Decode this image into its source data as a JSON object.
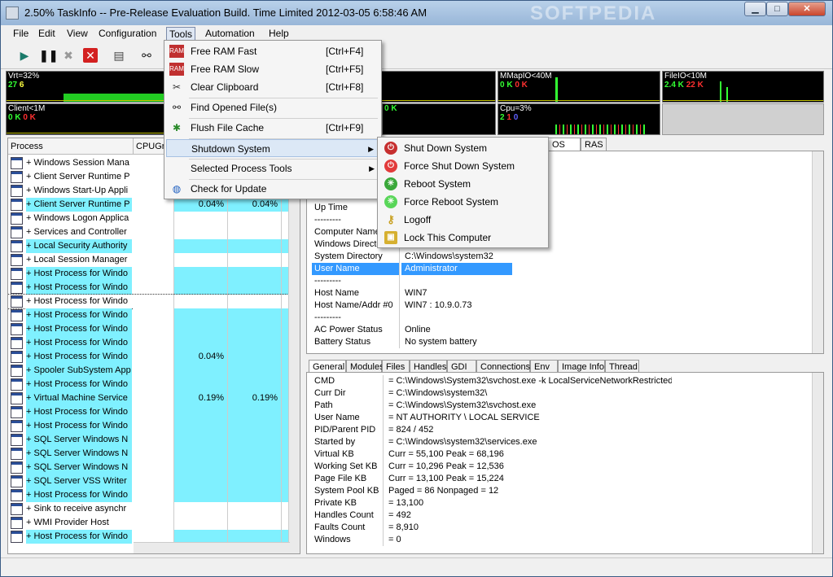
{
  "window": {
    "title": "2.50% TaskInfo -- Pre-Release Evaluation Build. Time Limited   2012-03-05 6:58:46 AM"
  },
  "watermark": "SOFTPEDIA",
  "menubar": {
    "items": [
      "File",
      "Edit",
      "View",
      "Configuration",
      "Tools",
      "Automation",
      "Help"
    ],
    "active": "Tools"
  },
  "graphs": {
    "vrt": {
      "label": "Vrt=32%",
      "v1": "27",
      "v2": "6"
    },
    "mmapio": {
      "label": "MMapIO<40M",
      "v1": "0 K",
      "v2": "0 K"
    },
    "fileio": {
      "label": "FileIO<10M",
      "v1": "2.4 K",
      "v2": "22 K"
    },
    "client": {
      "label": "Client<1M",
      "v1": "0 K",
      "v2": "0 K"
    },
    "mid2": {
      "label": "0 K"
    },
    "cpu": {
      "label": "Cpu=3%",
      "v1": "2",
      "v2": "1",
      "v3": "0"
    }
  },
  "process_panel": {
    "headers": {
      "process": "Process",
      "cpugraph": "CPUGraph"
    },
    "rows": [
      {
        "name": "+ Windows Session Mana",
        "c1": "",
        "c2": "",
        "cyan": false
      },
      {
        "name": "+ Client Server Runtime P",
        "c1": "",
        "c2": "",
        "cyan": false
      },
      {
        "name": "+ Windows Start-Up Appli",
        "c1": "",
        "c2": "",
        "cyan": false
      },
      {
        "name": "+ Client Server Runtime P",
        "c1": "0.04%",
        "c2": "0.04%",
        "cyan": true
      },
      {
        "name": "+ Windows Logon Applica",
        "c1": "",
        "c2": "",
        "cyan": false
      },
      {
        "name": "+ Services and Controller",
        "c1": "",
        "c2": "",
        "cyan": false
      },
      {
        "name": "+ Local Security Authority",
        "c1": "",
        "c2": "",
        "cyan": true
      },
      {
        "name": "+ Local Session Manager",
        "c1": "",
        "c2": "",
        "cyan": false
      },
      {
        "name": "+ Host Process for Windo",
        "c1": "",
        "c2": "",
        "cyan": true
      },
      {
        "name": "+ Host Process for Windo",
        "c1": "",
        "c2": "",
        "cyan": true
      },
      {
        "name": "+ Host Process for Windo",
        "c1": "",
        "c2": "",
        "cyan": false,
        "sel": true
      },
      {
        "name": "+ Host Process for Windo",
        "c1": "",
        "c2": "",
        "cyan": true
      },
      {
        "name": "+ Host Process for Windo",
        "c1": "",
        "c2": "",
        "cyan": true
      },
      {
        "name": "+ Host Process for Windo",
        "c1": "",
        "c2": "",
        "cyan": true
      },
      {
        "name": "+ Host Process for Windo",
        "c1": "0.04%",
        "c2": "",
        "cyan": true
      },
      {
        "name": "+ Spooler SubSystem App",
        "c1": "",
        "c2": "",
        "cyan": true
      },
      {
        "name": "+ Host Process for Windo",
        "c1": "",
        "c2": "",
        "cyan": true
      },
      {
        "name": "+ Virtual Machine Service",
        "c1": "0.19%",
        "c2": "0.19%",
        "cyan": true
      },
      {
        "name": "+ Host Process for Windo",
        "c1": "",
        "c2": "",
        "cyan": true
      },
      {
        "name": "+ Host Process for Windo",
        "c1": "",
        "c2": "",
        "cyan": true
      },
      {
        "name": "+ SQL Server Windows N",
        "c1": "",
        "c2": "",
        "cyan": true
      },
      {
        "name": "+ SQL Server Windows N",
        "c1": "",
        "c2": "",
        "cyan": true
      },
      {
        "name": "+ SQL Server Windows N",
        "c1": "",
        "c2": "",
        "cyan": true
      },
      {
        "name": "+ SQL Server VSS Writer",
        "c1": "",
        "c2": "",
        "cyan": true
      },
      {
        "name": "+ Host Process for Windo",
        "c1": "",
        "c2": "",
        "cyan": true
      },
      {
        "name": "+ Sink to receive asynchr",
        "c1": "",
        "c2": "",
        "cyan": false
      },
      {
        "name": "+ WMI Provider Host",
        "c1": "",
        "c2": "",
        "cyan": false
      },
      {
        "name": "+ Host Process for Windo",
        "c1": "",
        "c2": "",
        "cyan": true
      }
    ]
  },
  "top_tabs": [
    "OS",
    "RAS"
  ],
  "os_info": [
    {
      "k": "Up Time",
      "v": ""
    },
    {
      "k": "---------",
      "v": ""
    },
    {
      "k": "Computer Name",
      "v": ""
    },
    {
      "k": "Windows Directo",
      "v": ""
    },
    {
      "k": "System Directory",
      "v": "C:\\Windows\\system32"
    },
    {
      "k": "User Name",
      "v": "Administrator",
      "hl": true
    },
    {
      "k": "---------",
      "v": ""
    },
    {
      "k": "Host Name",
      "v": "WIN7"
    },
    {
      "k": "Host Name/Addr #0",
      "v": "WIN7  : 10.9.0.73"
    },
    {
      "k": "---------",
      "v": ""
    },
    {
      "k": "AC Power Status",
      "v": "Online"
    },
    {
      "k": "Battery Status",
      "v": "No system battery"
    }
  ],
  "bottom_tabs": [
    "General",
    "Modules",
    "Files",
    "Handles",
    "GDI",
    "Connections",
    "Env",
    "Image Info",
    "Thread"
  ],
  "general_info": [
    {
      "k": "CMD",
      "v": "= C:\\Windows\\System32\\svchost.exe -k LocalServiceNetworkRestricted"
    },
    {
      "k": "Curr Dir",
      "v": "= C:\\Windows\\system32\\"
    },
    {
      "k": "Path",
      "v": "= C:\\Windows\\System32\\svchost.exe"
    },
    {
      "k": "User Name",
      "v": "= NT AUTHORITY \\ LOCAL SERVICE"
    },
    {
      "k": "PID/Parent PID",
      "v": "= 824 / 452"
    },
    {
      "k": "Started by",
      "v": "= C:\\Windows\\system32\\services.exe"
    },
    {
      "k": "Virtual KB",
      "v": "Curr = 55,100 Peak = 68,196"
    },
    {
      "k": "Working Set KB",
      "v": "Curr = 10,296 Peak = 12,536"
    },
    {
      "k": "Page File KB",
      "v": "Curr = 13,100 Peak = 15,224"
    },
    {
      "k": "System Pool KB",
      "v": "Paged = 86 Nonpaged = 12"
    },
    {
      "k": "Private KB",
      "v": "= 13,100"
    },
    {
      "k": "Handles Count",
      "v": "= 492"
    },
    {
      "k": "Faults Count",
      "v": "= 8,910"
    },
    {
      "k": "Windows",
      "v": "= 0"
    }
  ],
  "tools_menu": [
    {
      "label": "Free RAM Fast",
      "shortcut": "[Ctrl+F4]",
      "icon": "ram-icon"
    },
    {
      "label": "Free RAM Slow",
      "shortcut": "[Ctrl+F5]",
      "icon": "ram-icon"
    },
    {
      "label": "Clear Clipboard",
      "shortcut": "[Ctrl+F8]",
      "icon": "clipboard-icon"
    },
    {
      "label": "Find Opened File(s)",
      "shortcut": "",
      "icon": "binoculars-icon"
    },
    {
      "label": "Flush File Cache",
      "shortcut": "[Ctrl+F9]",
      "icon": "tools-icon"
    },
    {
      "label": "Shutdown System",
      "shortcut": "",
      "icon": "",
      "submenu": true
    },
    {
      "label": "Selected Process Tools",
      "shortcut": "",
      "icon": "",
      "submenu": true
    },
    {
      "label": "Check for Update",
      "shortcut": "",
      "icon": "globe-icon"
    }
  ],
  "shutdown_menu": [
    {
      "label": "Shut Down System",
      "icon": "power-icon",
      "color": "#c62f2f"
    },
    {
      "label": "Force Shut Down System",
      "icon": "power-icon",
      "color": "#e23b3b"
    },
    {
      "label": "Reboot  System",
      "icon": "reboot-icon",
      "color": "#3aa83a"
    },
    {
      "label": "Force Reboot System",
      "icon": "reboot-icon",
      "color": "#59d659"
    },
    {
      "label": "Logoff",
      "icon": "keys-icon",
      "color": "#c8a020"
    },
    {
      "label": "Lock This Computer",
      "icon": "lock-icon",
      "color": "#d6b030"
    }
  ]
}
